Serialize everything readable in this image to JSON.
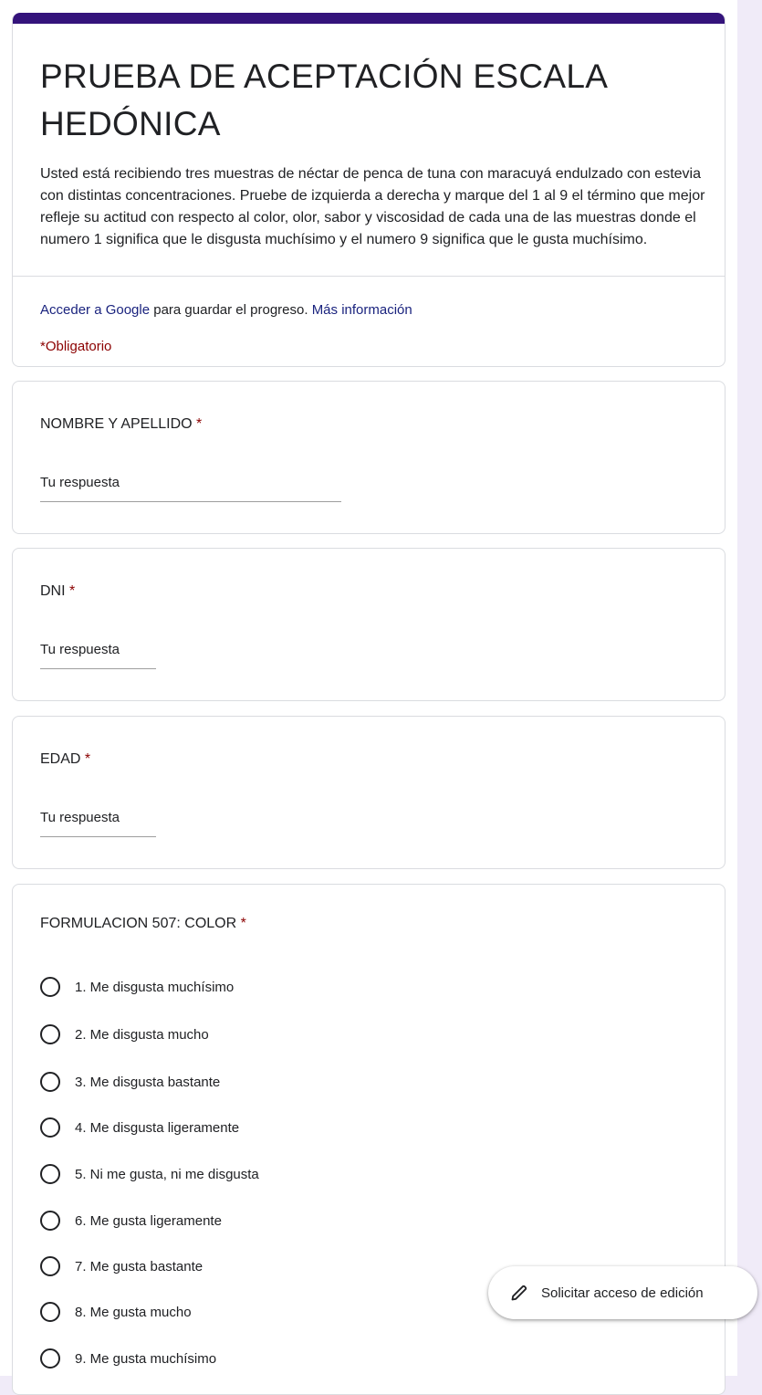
{
  "header": {
    "title": "PRUEBA DE ACEPTACIÓN ESCALA HEDÓNICA",
    "description": "Usted está recibiendo tres muestras de néctar de penca de tuna con maracuyá endulzado con estevia con distintas concentraciones. Pruebe de izquierda a derecha y marque del 1 al 9 el término que mejor refleje su actitud con respecto al color, olor, sabor y viscosidad de cada una de las muestras donde el numero 1 significa que le disgusta muchísimo y el numero 9 significa que le gusta muchísimo.",
    "signin_link": "Acceder a Google",
    "signin_text": " para guardar el progreso. ",
    "more_info_link": "Más información",
    "required_note": "*Obligatorio",
    "accent_color": "#34137b"
  },
  "questions": {
    "name": {
      "label": "NOMBRE Y APELLIDO",
      "required_mark": "*",
      "placeholder": "Tu respuesta"
    },
    "dni": {
      "label": "DNI",
      "required_mark": "*",
      "placeholder": "Tu respuesta"
    },
    "age": {
      "label": "EDAD",
      "required_mark": "*",
      "placeholder": "Tu respuesta"
    },
    "color507": {
      "label": "FORMULACION 507: COLOR",
      "required_mark": "*",
      "options": [
        "1. Me disgusta muchísimo",
        "2. Me disgusta mucho",
        "3. Me disgusta bastante",
        "4. Me disgusta ligeramente",
        "5. Ni me gusta, ni me disgusta",
        "6. Me gusta ligeramente",
        "7. Me gusta bastante",
        "8. Me gusta mucho",
        "9. Me gusta muchísimo"
      ]
    }
  },
  "fab": {
    "icon": "pencil-icon",
    "label": "Solicitar acceso de edición"
  }
}
